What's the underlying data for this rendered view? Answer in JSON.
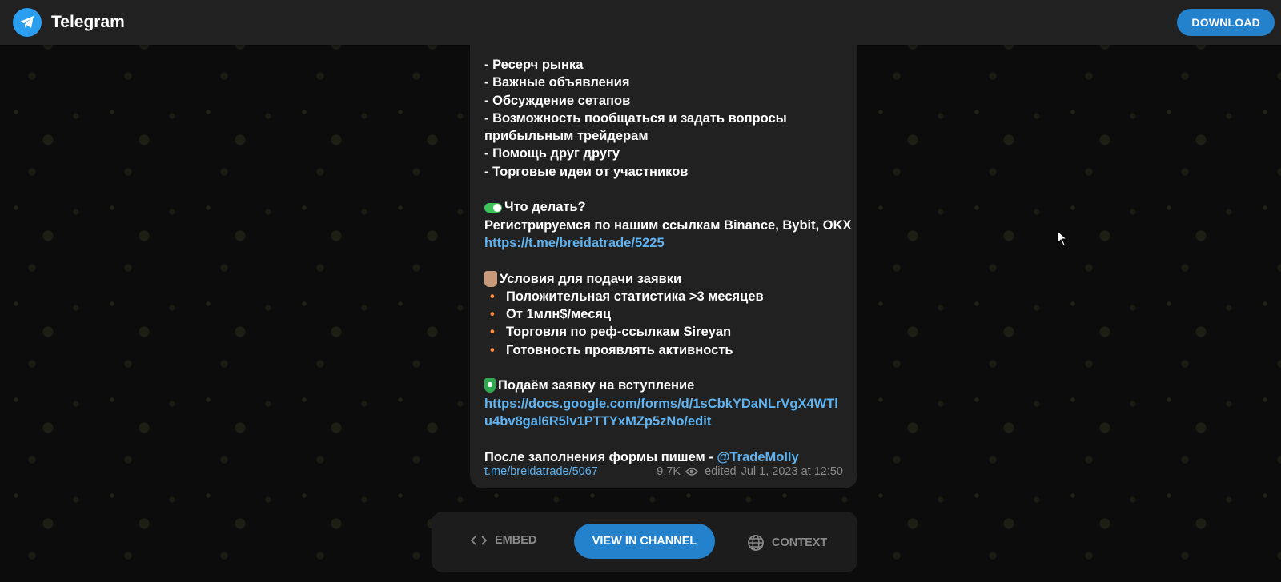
{
  "header": {
    "title": "Telegram",
    "download_label": "DOWNLOAD"
  },
  "message": {
    "lines": [
      "- Ресерч рынка",
      "- Важные объявления",
      "- Обсуждение сетапов",
      "- Возможность пообщаться и задать вопросы",
      "прибыльным трейдерам",
      "- Помощь друг другу",
      "- Торговые идеи от участников"
    ],
    "what_todo_heading": "Что делать?",
    "register_text": "Регистрируемся по нашим ссылкам Binance, Bybit, OKX",
    "register_link": "https://t.me/breidatrade/5225",
    "conditions_heading": "Условия для подачи заявки",
    "conditions": [
      "Положительная статистика >3 месяцев",
      "От 1млн$/месяц",
      "Торговля по реф-ссылкам Sireyan",
      "Готовность проявлять активность"
    ],
    "apply_heading": "Подаём заявку на вступление",
    "form_link_line1": "https://docs.google.com/forms/d/1sCbkYDaNLrVgX4WTl",
    "form_link_line2": "u4bv8gal6R5lv1PTTYxMZp5zNo/edit",
    "after_text": "После заполнения формы пишем - ",
    "contact": "@TradeMolly",
    "footer": {
      "source_link": "t.me/breidatrade/5067",
      "views": "9.7K",
      "edited": "edited",
      "date": "Jul 1, 2023 at 12:50"
    }
  },
  "actions": {
    "embed": "EMBED",
    "view_in_channel": "VIEW IN CHANNEL",
    "context": "CONTEXT"
  },
  "colors": {
    "accent": "#2481cc",
    "link": "#5fb3f0",
    "bubble": "#212121",
    "bullet": "#ff8a3d"
  }
}
